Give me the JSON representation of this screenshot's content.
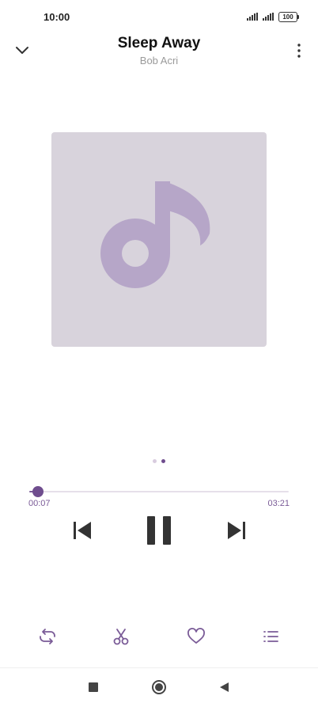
{
  "status_bar": {
    "time": "10:00",
    "battery": "100"
  },
  "header": {
    "title": "Sleep Away",
    "artist": "Bob Acri",
    "collapse_icon": "chevron-down-icon",
    "more_icon": "more-vertical-icon"
  },
  "artwork": {
    "icon": "music-note-icon",
    "background_color": "#d8d3dc",
    "icon_color": "#b6a6c8"
  },
  "pager": {
    "pages": 2,
    "active_page": 2
  },
  "playback": {
    "elapsed": "00:07",
    "total": "03:21",
    "progress_fraction": 0.035,
    "state": "playing",
    "accent_color": "#6f4d8e"
  },
  "controls": {
    "previous_icon": "skip-previous-icon",
    "pause_icon": "pause-icon",
    "next_icon": "skip-next-icon"
  },
  "actions": [
    {
      "name": "repeat",
      "icon": "repeat-icon"
    },
    {
      "name": "cut",
      "icon": "scissors-icon"
    },
    {
      "name": "favorite",
      "icon": "heart-icon"
    },
    {
      "name": "queue",
      "icon": "playlist-icon"
    }
  ],
  "nav_bar": {
    "recents_icon": "square-icon",
    "home_icon": "circle-icon",
    "back_icon": "triangle-back-icon"
  }
}
